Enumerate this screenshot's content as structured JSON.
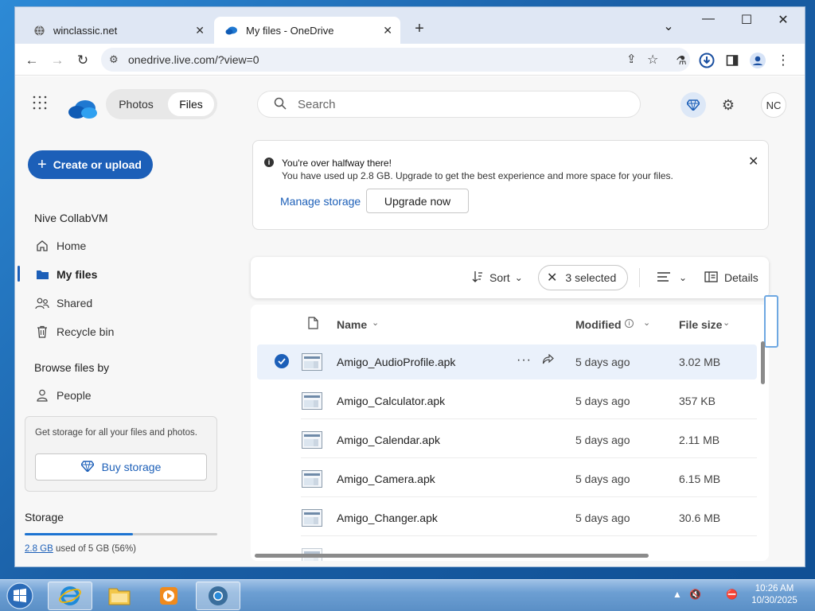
{
  "browser": {
    "tabs": [
      {
        "title": "winclassic.net",
        "favicon": "globe-icon"
      },
      {
        "title": "My files - OneDrive",
        "favicon": "onedrive-cloud-icon"
      }
    ],
    "url": "onedrive.live.com/?view=0"
  },
  "header": {
    "switch": {
      "photos": "Photos",
      "files": "Files"
    },
    "search_placeholder": "Search",
    "avatar_initials": "NC"
  },
  "sidebar": {
    "create_label": "Create or upload",
    "account_name": "Nive CollabVM",
    "nav": [
      {
        "label": "Home",
        "icon": "home-icon"
      },
      {
        "label": "My files",
        "icon": "folder-icon"
      },
      {
        "label": "Shared",
        "icon": "people-icon"
      },
      {
        "label": "Recycle bin",
        "icon": "trash-icon"
      }
    ],
    "browse_heading": "Browse files by",
    "browse_items": [
      {
        "label": "People",
        "icon": "person-icon"
      }
    ],
    "storage_card": {
      "message": "Get storage for all your files and photos.",
      "button": "Buy storage"
    },
    "storage": {
      "heading": "Storage",
      "used": "2.8 GB",
      "rest": " used of 5 GB (56%)",
      "fraction": 0.56
    }
  },
  "banner": {
    "title": "You're over halfway there!",
    "body": "You have used up 2.8 GB. Upgrade to get the best experience and more space for your files.",
    "manage_label": "Manage storage",
    "upgrade_label": "Upgrade now"
  },
  "command_bar": {
    "sort": "Sort",
    "selected": "3 selected",
    "details": "Details"
  },
  "file_list": {
    "columns": {
      "name": "Name",
      "modified": "Modified",
      "size": "File size"
    },
    "rows": [
      {
        "name": "Amigo_AudioProfile.apk",
        "modified": "5 days ago",
        "size": "3.02 MB",
        "selected": true
      },
      {
        "name": "Amigo_Calculator.apk",
        "modified": "5 days ago",
        "size": "357 KB",
        "selected": false
      },
      {
        "name": "Amigo_Calendar.apk",
        "modified": "5 days ago",
        "size": "2.11 MB",
        "selected": false
      },
      {
        "name": "Amigo_Camera.apk",
        "modified": "5 days ago",
        "size": "6.15 MB",
        "selected": false
      },
      {
        "name": "Amigo_Changer.apk",
        "modified": "5 days ago",
        "size": "30.6 MB",
        "selected": false
      }
    ]
  },
  "taskbar": {
    "time": "10:26 AM",
    "date": "10/30/2025"
  },
  "colors": {
    "accent": "#1c5fb8",
    "taskbar": "#5a8fc6"
  }
}
